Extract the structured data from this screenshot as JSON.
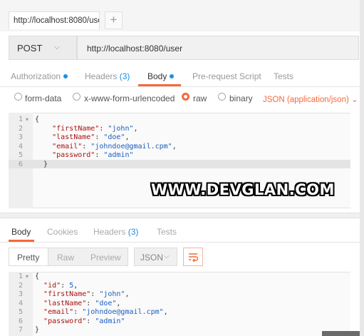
{
  "request_tab": {
    "title": "http://localhost:8080/user",
    "add_icon": "plus"
  },
  "method": {
    "label": "POST"
  },
  "url": {
    "value": "http://localhost:8080/user"
  },
  "request_tabs": [
    {
      "label": "Authorization",
      "dot": true
    },
    {
      "label": "Headers",
      "count": "(3)"
    },
    {
      "label": "Body",
      "dot": true,
      "active": true
    },
    {
      "label": "Pre-request Script"
    },
    {
      "label": "Tests"
    }
  ],
  "body_modes": [
    {
      "label": "form-data",
      "selected": false
    },
    {
      "label": "x-www-form-urlencoded",
      "selected": false
    },
    {
      "label": "raw",
      "selected": true
    },
    {
      "label": "binary",
      "selected": false
    }
  ],
  "content_type": {
    "label": "JSON (application/json)"
  },
  "request_body": {
    "line_numbers": [
      "1",
      "2",
      "3",
      "4",
      "5",
      "6"
    ],
    "fields": [
      {
        "key": "\"firstName\"",
        "value": "\"john\""
      },
      {
        "key": "\"lastName\"",
        "value": "\"doe\""
      },
      {
        "key": "\"email\"",
        "value": "\"johndoe@gmail.cpm\""
      },
      {
        "key": "\"password\"",
        "value": "\"admin\""
      }
    ]
  },
  "watermark": "WWW.DEVGLAN.COM",
  "response_tabs": [
    {
      "label": "Body",
      "active": true
    },
    {
      "label": "Cookies"
    },
    {
      "label": "Headers",
      "count": "(3)"
    },
    {
      "label": "Tests"
    }
  ],
  "view_modes": [
    "Pretty",
    "Raw",
    "Preview"
  ],
  "format": {
    "label": "JSON"
  },
  "response_body": {
    "line_numbers": [
      "1",
      "2",
      "3",
      "4",
      "5",
      "6",
      "7"
    ],
    "id": "5",
    "fields": [
      {
        "key": "\"firstName\"",
        "value": "\"john\""
      },
      {
        "key": "\"lastName\"",
        "value": "\"doe\""
      },
      {
        "key": "\"email\"",
        "value": "\"johndoe@gmail.cpm\""
      },
      {
        "key": "\"password\"",
        "value": "\"admin\""
      }
    ]
  },
  "colors": {
    "accent": "#f26b3a",
    "link": "#1b8fe6"
  }
}
